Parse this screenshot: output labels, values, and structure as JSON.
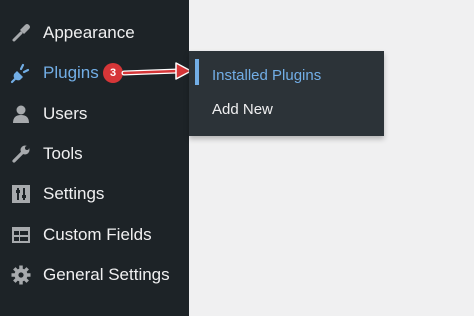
{
  "sidebar": {
    "items": [
      {
        "label": "Appearance",
        "icon": "paintbrush-icon"
      },
      {
        "label": "Plugins",
        "icon": "plug-icon",
        "badge": "3",
        "active": true
      },
      {
        "label": "Users",
        "icon": "user-icon"
      },
      {
        "label": "Tools",
        "icon": "wrench-icon"
      },
      {
        "label": "Settings",
        "icon": "sliders-icon"
      },
      {
        "label": "Custom Fields",
        "icon": "table-icon"
      },
      {
        "label": "General Settings",
        "icon": "gear-icon"
      }
    ]
  },
  "flyout": {
    "items": [
      {
        "label": "Installed Plugins",
        "current": true
      },
      {
        "label": "Add New"
      }
    ]
  },
  "colors": {
    "sidebar_bg": "#1d2327",
    "flyout_bg": "#2c3338",
    "accent": "#72aee6",
    "badge": "#d63638",
    "arrow": "#d63638",
    "page_bg": "#f0f0f1"
  }
}
